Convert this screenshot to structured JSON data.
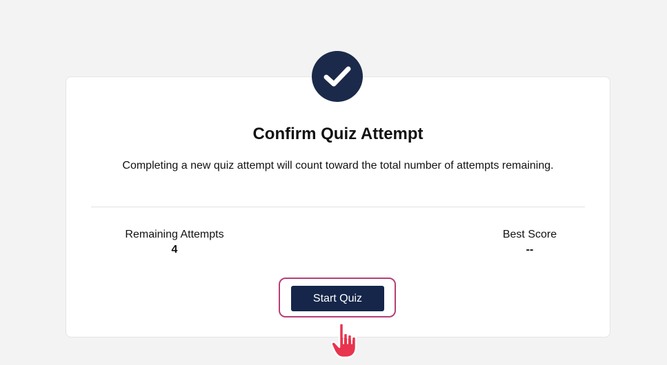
{
  "dialog": {
    "title": "Confirm Quiz Attempt",
    "description": "Completing a new quiz attempt will count toward the total number of attempts remaining.",
    "icon": "check-circle-icon"
  },
  "stats": {
    "remaining_label": "Remaining Attempts",
    "remaining_value": "4",
    "best_label": "Best Score",
    "best_value": "--"
  },
  "actions": {
    "start_label": "Start Quiz"
  },
  "colors": {
    "badge": "#1b2a4a",
    "button": "#15264a",
    "focus_ring": "#b73e75",
    "cursor": "#e8344e"
  },
  "cursor": {
    "icon": "hand-pointer-icon"
  }
}
